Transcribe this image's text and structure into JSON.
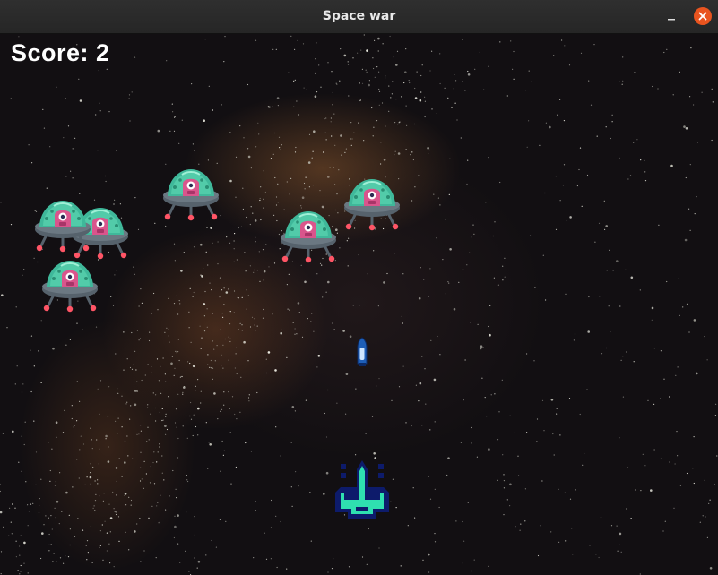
{
  "window": {
    "title": "Space war"
  },
  "hud": {
    "score_text": "Score: 2"
  },
  "colors": {
    "titlebar": "#2b2b2b",
    "close_button": "#e9541f",
    "ufo_dome": "#3fb89a",
    "ufo_body": "#55616b",
    "ufo_alien": "#d9558c",
    "ufo_lights": "#ff5566",
    "player_body": "#2fe0b0",
    "player_outline": "#0d1b6b",
    "bullet": "#3f8fe0"
  },
  "icons": {
    "minimize": "minimize-icon",
    "close": "close-icon",
    "enemy": "ufo-enemy-icon",
    "player": "spaceship-player-icon",
    "bullet": "bullet-icon"
  },
  "enemies_count": 6
}
